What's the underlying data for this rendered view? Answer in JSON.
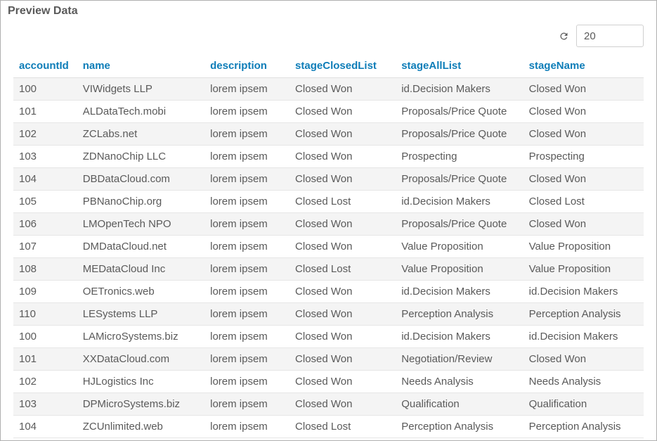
{
  "panel": {
    "title": "Preview Data"
  },
  "toolbar": {
    "rowCount": "20"
  },
  "table": {
    "columns": [
      "accountId",
      "name",
      "description",
      "stageClosedList",
      "stageAllList",
      "stageName"
    ],
    "rows": [
      {
        "accountId": "100",
        "name": "VIWidgets LLP",
        "description": "lorem ipsem",
        "stageClosedList": "Closed Won",
        "stageAllList": "id.Decision Makers",
        "stageName": "Closed Won"
      },
      {
        "accountId": "101",
        "name": "ALDataTech.mobi",
        "description": "lorem ipsem",
        "stageClosedList": "Closed Won",
        "stageAllList": "Proposals/Price Quote",
        "stageName": "Closed Won"
      },
      {
        "accountId": "102",
        "name": "ZCLabs.net",
        "description": "lorem ipsem",
        "stageClosedList": "Closed Won",
        "stageAllList": "Proposals/Price Quote",
        "stageName": "Closed Won"
      },
      {
        "accountId": "103",
        "name": "ZDNanoChip LLC",
        "description": "lorem ipsem",
        "stageClosedList": "Closed Won",
        "stageAllList": "Prospecting",
        "stageName": "Prospecting"
      },
      {
        "accountId": "104",
        "name": "DBDataCloud.com",
        "description": "lorem ipsem",
        "stageClosedList": "Closed Won",
        "stageAllList": "Proposals/Price Quote",
        "stageName": "Closed Won"
      },
      {
        "accountId": "105",
        "name": "PBNanoChip.org",
        "description": "lorem ipsem",
        "stageClosedList": "Closed Lost",
        "stageAllList": "id.Decision Makers",
        "stageName": "Closed Lost"
      },
      {
        "accountId": "106",
        "name": "LMOpenTech NPO",
        "description": "lorem ipsem",
        "stageClosedList": "Closed Won",
        "stageAllList": "Proposals/Price Quote",
        "stageName": "Closed Won"
      },
      {
        "accountId": "107",
        "name": "DMDataCloud.net",
        "description": "lorem ipsem",
        "stageClosedList": "Closed Won",
        "stageAllList": "Value Proposition",
        "stageName": "Value Proposition"
      },
      {
        "accountId": "108",
        "name": "MEDataCloud Inc",
        "description": "lorem ipsem",
        "stageClosedList": "Closed Lost",
        "stageAllList": "Value Proposition",
        "stageName": "Value Proposition"
      },
      {
        "accountId": "109",
        "name": "OETronics.web",
        "description": "lorem ipsem",
        "stageClosedList": "Closed Won",
        "stageAllList": "id.Decision Makers",
        "stageName": "id.Decision Makers"
      },
      {
        "accountId": "110",
        "name": "LESystems LLP",
        "description": "lorem ipsem",
        "stageClosedList": "Closed Won",
        "stageAllList": "Perception Analysis",
        "stageName": "Perception Analysis"
      },
      {
        "accountId": "100",
        "name": "LAMicroSystems.biz",
        "description": "lorem ipsem",
        "stageClosedList": "Closed Won",
        "stageAllList": "id.Decision Makers",
        "stageName": "id.Decision Makers"
      },
      {
        "accountId": "101",
        "name": "XXDataCloud.com",
        "description": "lorem ipsem",
        "stageClosedList": "Closed Won",
        "stageAllList": "Negotiation/Review",
        "stageName": "Closed Won"
      },
      {
        "accountId": "102",
        "name": "HJLogistics Inc",
        "description": "lorem ipsem",
        "stageClosedList": "Closed Won",
        "stageAllList": "Needs Analysis",
        "stageName": "Needs Analysis"
      },
      {
        "accountId": "103",
        "name": "DPMicroSystems.biz",
        "description": "lorem ipsem",
        "stageClosedList": "Closed Won",
        "stageAllList": "Qualification",
        "stageName": "Qualification"
      },
      {
        "accountId": "104",
        "name": "ZCUnlimited.web",
        "description": "lorem ipsem",
        "stageClosedList": "Closed Lost",
        "stageAllList": "Perception Analysis",
        "stageName": "Perception Analysis"
      }
    ]
  }
}
